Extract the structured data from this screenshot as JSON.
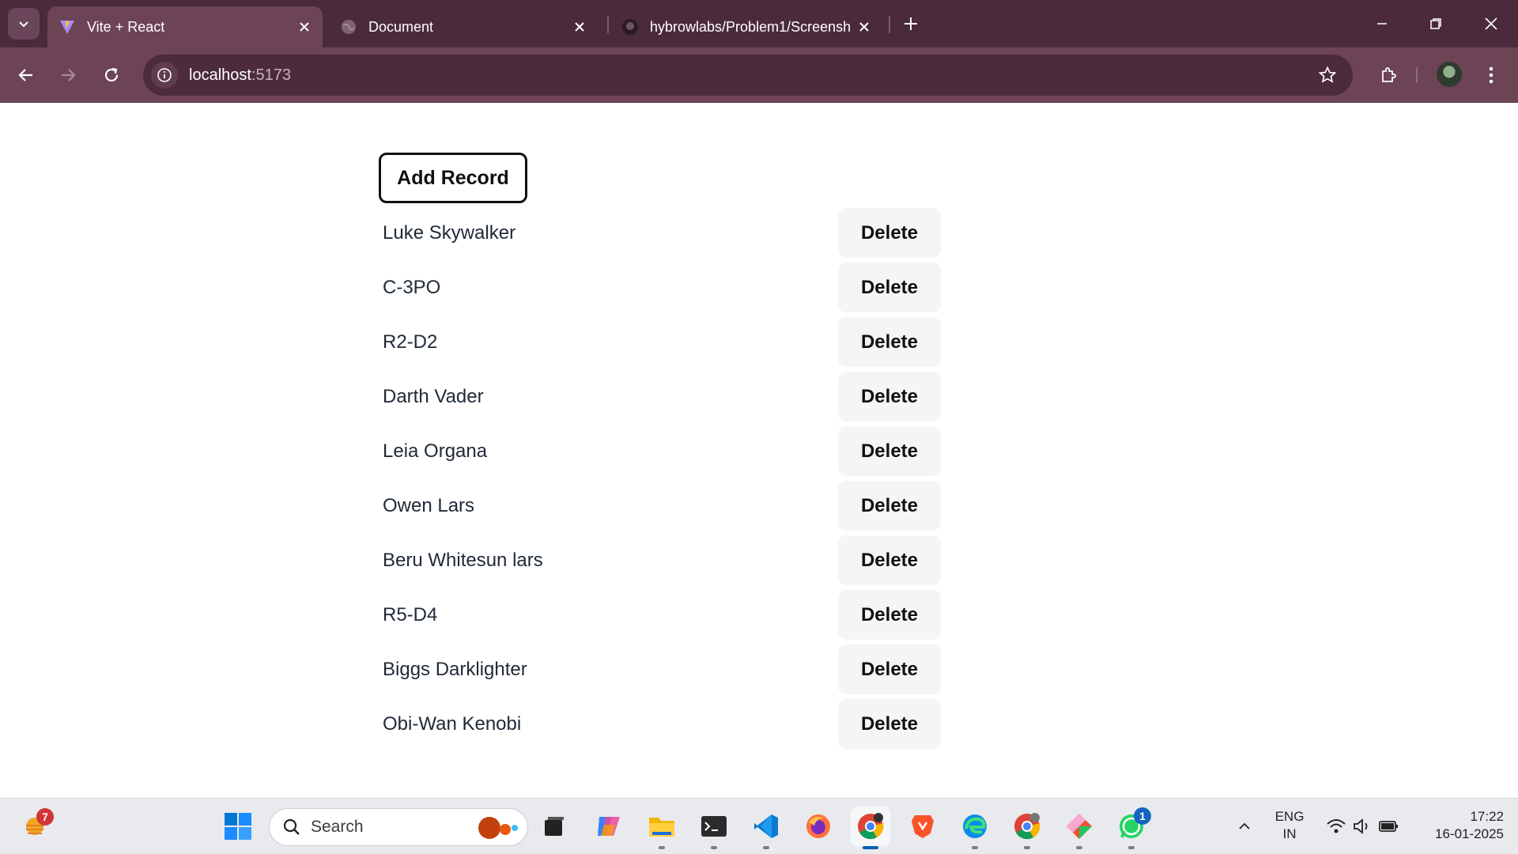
{
  "browser": {
    "tabs": [
      {
        "title": "Vite + React",
        "active": true
      },
      {
        "title": "Document",
        "active": false
      },
      {
        "title": "hybrowlabs/Problem1/Screensh",
        "active": false
      }
    ],
    "url_host": "localhost",
    "url_port": ":5173"
  },
  "page": {
    "add_button_label": "Add Record",
    "delete_label": "Delete",
    "records": [
      "Luke Skywalker",
      "C-3PO",
      "R2-D2",
      "Darth Vader",
      "Leia Organa",
      "Owen Lars",
      "Beru Whitesun lars",
      "R5-D4",
      "Biggs Darklighter",
      "Obi-Wan Kenobi"
    ]
  },
  "taskbar": {
    "weather_badge": "7",
    "search_label": "Search",
    "whatsapp_badge": "1",
    "language_line1": "ENG",
    "language_line2": "IN",
    "time": "17:22",
    "date": "16-01-2025"
  },
  "colors": {
    "tabstrip": "#4b2a3c",
    "toolbar": "#6d4356",
    "delete_button_bg": "#f5f5f5"
  },
  "icons": [
    "chevron-down-icon",
    "vite-icon",
    "globe-icon",
    "github-icon",
    "close-icon",
    "plus-icon",
    "minimize-icon",
    "restore-icon",
    "back-arrow-icon",
    "forward-arrow-icon",
    "reload-icon",
    "info-icon",
    "star-icon",
    "extensions-icon",
    "kebab-menu-icon",
    "windows-start-icon",
    "search-icon"
  ]
}
